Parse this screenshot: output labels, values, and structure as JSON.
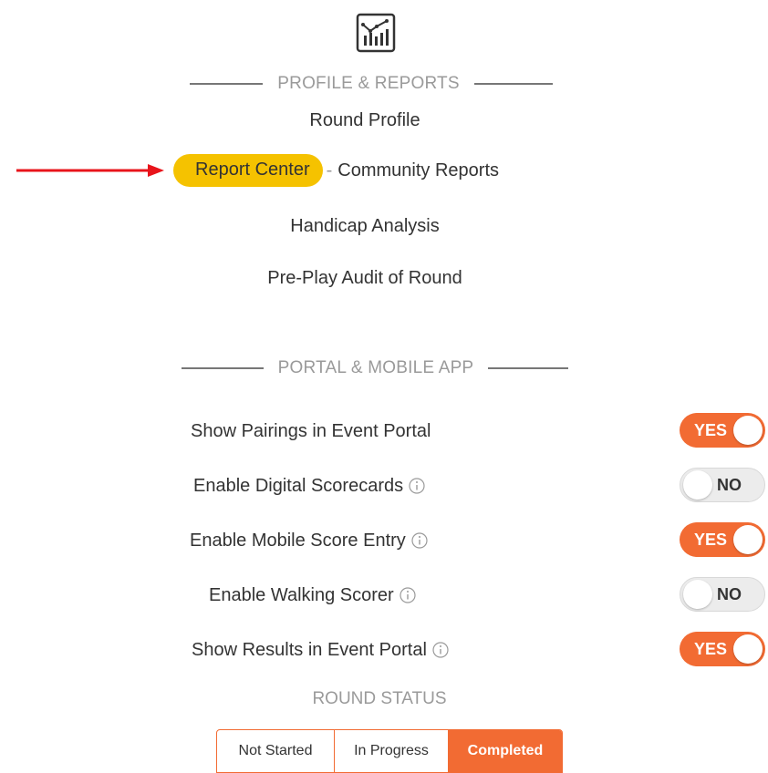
{
  "profile_reports": {
    "header_icon": "bar-chart-trend-icon",
    "section_title": "PROFILE & REPORTS",
    "round_profile": "Round Profile",
    "report_center": "Report Center",
    "separator": "-",
    "community_reports": "Community Reports",
    "handicap_analysis": "Handicap Analysis",
    "pre_play_audit": "Pre-Play Audit of Round"
  },
  "portal_mobile": {
    "section_title": "PORTAL & MOBILE APP",
    "settings": [
      {
        "label": "Show Pairings in Event Portal",
        "info": false,
        "value": "YES",
        "on": true
      },
      {
        "label": "Enable Digital Scorecards",
        "info": true,
        "value": "NO",
        "on": false
      },
      {
        "label": "Enable Mobile Score Entry",
        "info": true,
        "value": "YES",
        "on": true
      },
      {
        "label": "Enable Walking Scorer",
        "info": true,
        "value": "NO",
        "on": false
      },
      {
        "label": "Show Results in Event Portal",
        "info": true,
        "value": "YES",
        "on": true
      }
    ]
  },
  "round_status": {
    "title": "ROUND STATUS",
    "options": [
      "Not Started",
      "In Progress",
      "Completed"
    ],
    "selected": "Completed"
  },
  "colors": {
    "accent": "#f26b33",
    "highlight": "#f5c200",
    "arrow": "#e8141b"
  }
}
